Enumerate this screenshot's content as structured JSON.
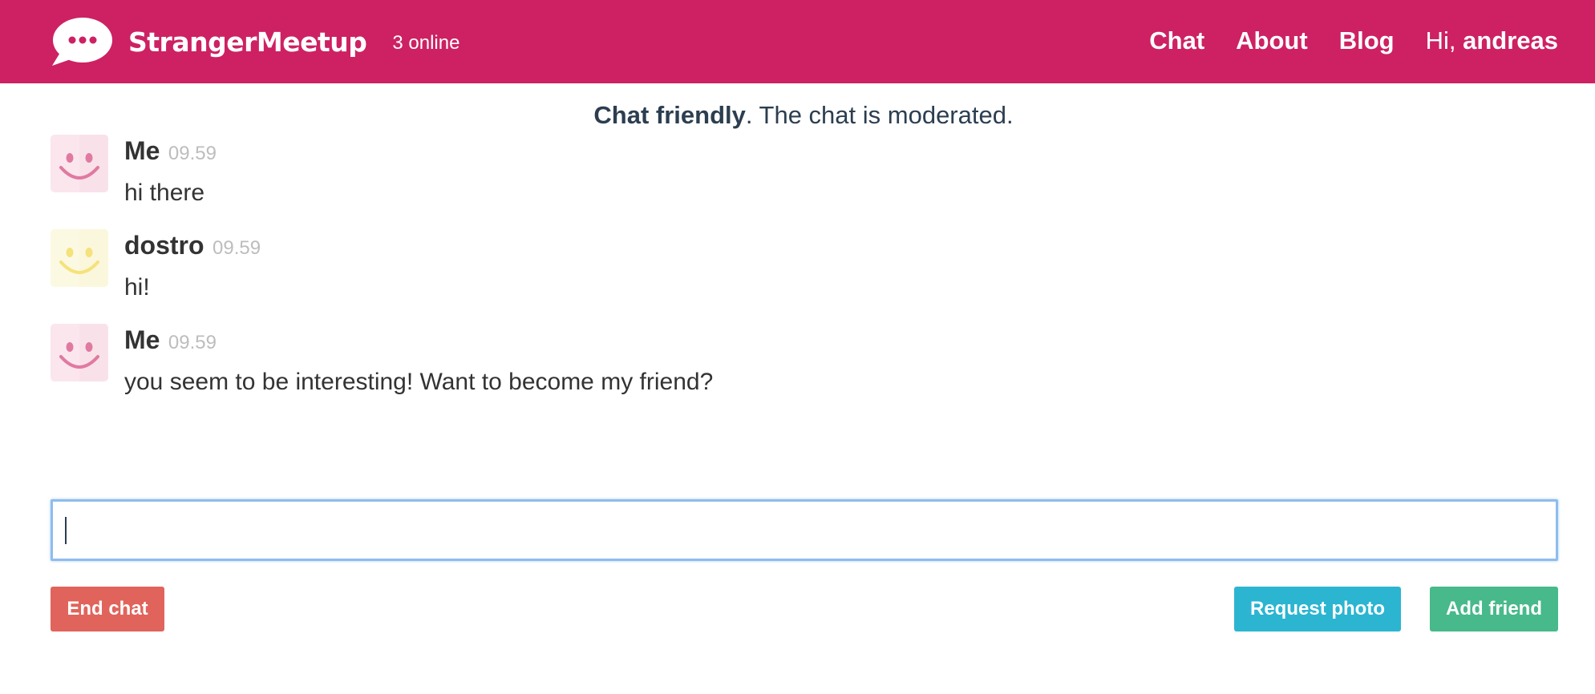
{
  "header": {
    "brand_name": "StrangerMeetup",
    "online_count": "3 online",
    "brand_color": "#cd2163",
    "logo_icon": "chat-bubble-ellipsis-icon",
    "nav": [
      {
        "label": "Chat"
      },
      {
        "label": "About"
      },
      {
        "label": "Blog"
      }
    ],
    "greeting_prefix": "Hi,",
    "username": "andreas"
  },
  "notice": {
    "bold": "Chat friendly",
    "rest": ". The chat is moderated."
  },
  "messages": [
    {
      "author": "Me",
      "time": "09.59",
      "text": "hi there",
      "avatar_icon": "smiley-icon",
      "avatar_color": "#e07aa0",
      "avatar_bg": "#fbe6ee"
    },
    {
      "author": "dostro",
      "time": "09.59",
      "text": "hi!",
      "avatar_icon": "smiley-icon",
      "avatar_color": "#f5e27a",
      "avatar_bg": "#fcf9e3"
    },
    {
      "author": "Me",
      "time": "09.59",
      "text": "you seem to be interesting! Want to become my friend?",
      "avatar_icon": "smiley-icon",
      "avatar_color": "#e07aa0",
      "avatar_bg": "#fbe6ee"
    }
  ],
  "input": {
    "value": "",
    "placeholder": ""
  },
  "actions": {
    "end_chat": "End chat",
    "request_photo": "Request photo",
    "add_friend": "Add friend",
    "end_color": "#e0645c",
    "photo_color": "#2bb5d1",
    "friend_color": "#48b98a"
  }
}
